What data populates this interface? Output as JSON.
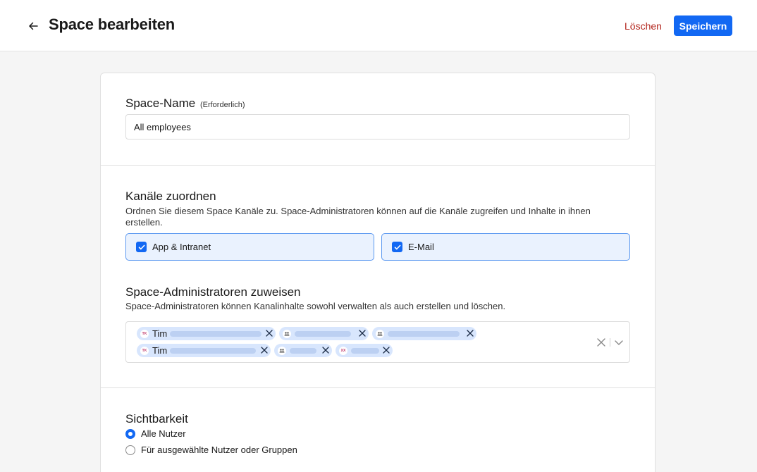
{
  "header": {
    "title": "Space bearbeiten",
    "delete_label": "Löschen",
    "save_label": "Speichern"
  },
  "space_name": {
    "label": "Space-Name",
    "required_hint": "(Erforderlich)",
    "value": "All employees"
  },
  "channels": {
    "heading": "Kanäle zuordnen",
    "description": "Ordnen Sie diesem Space Kanäle zu. Space-Administratoren können auf die Kanäle zugreifen und Inhalte in ihnen erstellen.",
    "items": [
      {
        "label": "App & Intranet",
        "checked": true
      },
      {
        "label": "E-Mail",
        "checked": true
      }
    ]
  },
  "admins": {
    "heading": "Space-Administratoren zuweisen",
    "description": "Space-Administratoren können Kanalinhalte sowohl verwalten als auch erstellen und löschen.",
    "chips": [
      {
        "name": "Tim",
        "avatar": "TK",
        "avatar_type": "initials"
      },
      {
        "name": "",
        "avatar": "group-icon",
        "avatar_type": "group"
      },
      {
        "name": "",
        "avatar": "group-icon",
        "avatar_type": "group"
      },
      {
        "name": "Tim",
        "avatar": "TK",
        "avatar_type": "initials"
      },
      {
        "name": "",
        "avatar": "group-icon",
        "avatar_type": "group"
      },
      {
        "name": "",
        "avatar": "XX",
        "avatar_type": "initials"
      }
    ]
  },
  "visibility": {
    "heading": "Sichtbarkeit",
    "options": [
      {
        "label": "Alle Nutzer",
        "selected": true
      },
      {
        "label": "Für ausgewählte Nutzer oder Gruppen",
        "selected": false
      }
    ]
  },
  "colors": {
    "primary": "#1268f3",
    "danger": "#b3261e",
    "chip_bg": "#d8e6fd",
    "selected_bg": "#eaf2fe"
  }
}
